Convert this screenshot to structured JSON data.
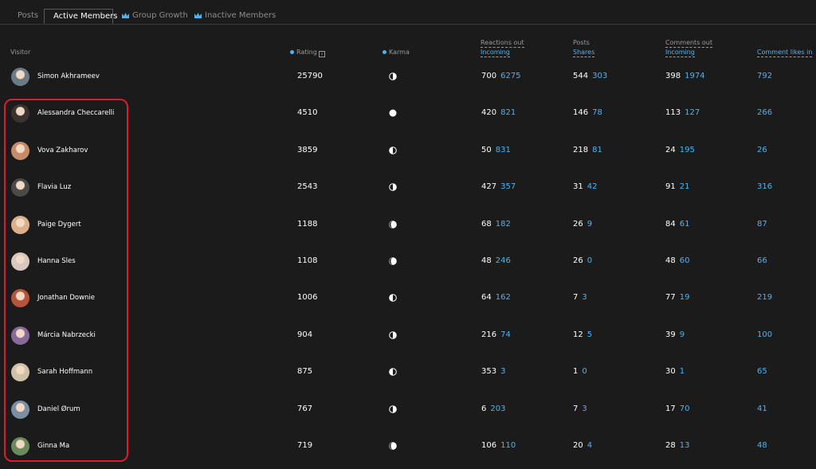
{
  "tabs": [
    {
      "label": "Posts",
      "icon": "",
      "active": false
    },
    {
      "label": "Active Members",
      "icon": "",
      "active": true
    },
    {
      "label": "Group Growth",
      "icon": "crown-icon",
      "active": false
    },
    {
      "label": "Inactive Members",
      "icon": "crown-icon",
      "active": false
    }
  ],
  "columns": {
    "visitor": "Visitor",
    "rating": "Rating",
    "karma": "Karma",
    "reactions_out": "Reactions out",
    "reactions_incoming": "Incoming",
    "posts": "Posts",
    "shares": "Shares",
    "comments_out": "Comments out",
    "comments_incoming": "Incoming",
    "comment_likes_in": "Comment likes in"
  },
  "rows": [
    {
      "name": "Simon Akhrameev",
      "rating": "25790",
      "karma": "half-right",
      "reactions_out": "700",
      "reactions_in": "6275",
      "posts": "544",
      "shares": "303",
      "comments_out": "398",
      "comments_in": "1974",
      "comment_likes_in": "792",
      "avatar_color": "#6b7a86"
    },
    {
      "name": "Alessandra Checcarelli",
      "rating": "4510",
      "karma": "full",
      "reactions_out": "420",
      "reactions_in": "821",
      "posts": "146",
      "shares": "78",
      "comments_out": "113",
      "comments_in": "127",
      "comment_likes_in": "266",
      "avatar_color": "#3a3330"
    },
    {
      "name": "Vova Zakharov",
      "rating": "3859",
      "karma": "half-left",
      "reactions_out": "50",
      "reactions_in": "831",
      "posts": "218",
      "shares": "81",
      "comments_out": "24",
      "comments_in": "195",
      "comment_likes_in": "26",
      "avatar_color": "#c78b6a"
    },
    {
      "name": "Flavia Luz",
      "rating": "2543",
      "karma": "half-right",
      "reactions_out": "427",
      "reactions_in": "357",
      "posts": "31",
      "shares": "42",
      "comments_out": "91",
      "comments_in": "21",
      "comment_likes_in": "316",
      "avatar_color": "#4a4a48"
    },
    {
      "name": "Paige Dygert",
      "rating": "1188",
      "karma": "mostly-full",
      "reactions_out": "68",
      "reactions_in": "182",
      "posts": "26",
      "shares": "9",
      "comments_out": "84",
      "comments_in": "61",
      "comment_likes_in": "87",
      "avatar_color": "#d9b08a"
    },
    {
      "name": "Hanna Sles",
      "rating": "1108",
      "karma": "mostly-full",
      "reactions_out": "48",
      "reactions_in": "246",
      "posts": "26",
      "shares": "0",
      "comments_out": "48",
      "comments_in": "60",
      "comment_likes_in": "66",
      "avatar_color": "#d8c6c0"
    },
    {
      "name": "Jonathan Downie",
      "rating": "1006",
      "karma": "half-left",
      "reactions_out": "64",
      "reactions_in": "162",
      "posts": "7",
      "shares": "3",
      "comments_out": "77",
      "comments_in": "19",
      "comment_likes_in": "219",
      "avatar_color": "#b5533b"
    },
    {
      "name": "Márcia Nabrzecki",
      "rating": "904",
      "karma": "half-right",
      "reactions_out": "216",
      "reactions_in": "74",
      "posts": "12",
      "shares": "5",
      "comments_out": "39",
      "comments_in": "9",
      "comment_likes_in": "100",
      "avatar_color": "#8a6a9a"
    },
    {
      "name": "Sarah Hoffmann",
      "rating": "875",
      "karma": "half-left",
      "reactions_out": "353",
      "reactions_in": "3",
      "posts": "1",
      "shares": "0",
      "comments_out": "30",
      "comments_in": "1",
      "comment_likes_in": "65",
      "avatar_color": "#cfc1a8"
    },
    {
      "name": "Daniel Ørum",
      "rating": "767",
      "karma": "half-right",
      "reactions_out": "6",
      "reactions_in": "203",
      "posts": "7",
      "shares": "3",
      "comments_out": "17",
      "comments_in": "70",
      "comment_likes_in": "41",
      "avatar_color": "#7b8fa3"
    },
    {
      "name": "Ginna Ma",
      "rating": "719",
      "karma": "mostly-full",
      "reactions_out": "106",
      "reactions_in": "110",
      "posts": "20",
      "shares": "4",
      "comments_out": "28",
      "comments_in": "13",
      "comment_likes_in": "48",
      "avatar_color": "#6b8a5c"
    }
  ],
  "colors": {
    "background": "#1b1b1b",
    "accent_blue": "#4fb3f0",
    "highlight_red": "#e0192c",
    "header_gray": "#9a9a9a"
  }
}
